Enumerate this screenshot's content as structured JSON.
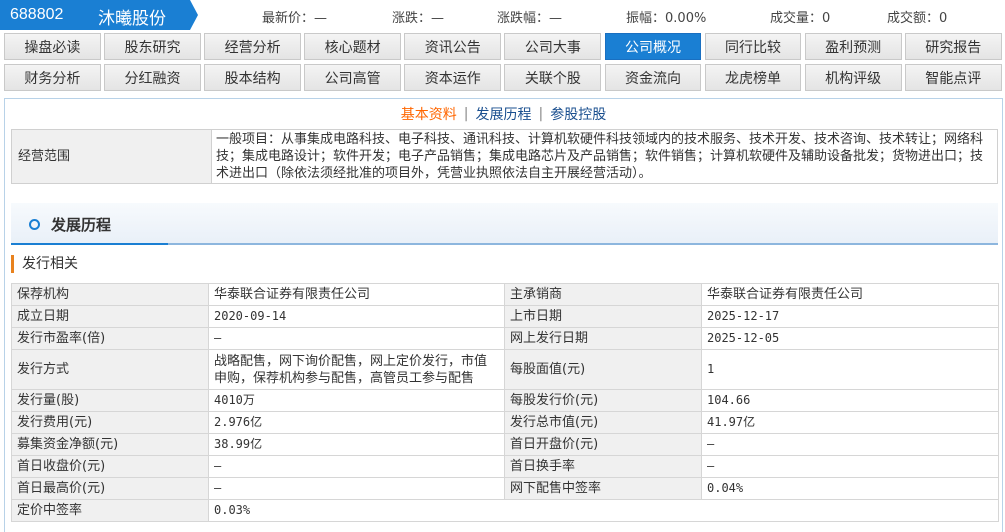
{
  "stock": {
    "code": "688802",
    "name": "沐曦股份",
    "tag_color": "#1a7fd3"
  },
  "quote": [
    {
      "label": "最新价：",
      "value": "—"
    },
    {
      "label": "涨跌：",
      "value": "—"
    },
    {
      "label": "涨跌幅：",
      "value": "—"
    },
    {
      "label": "振幅：",
      "value": "0.00%"
    },
    {
      "label": "成交量：",
      "value": "0"
    },
    {
      "label": "成交额：",
      "value": "0"
    }
  ],
  "nav": {
    "active_index": 6,
    "items": [
      "操盘必读",
      "股东研究",
      "经营分析",
      "核心题材",
      "资讯公告",
      "公司大事",
      "公司概况",
      "同行比较",
      "盈利预测",
      "研究报告",
      "财务分析",
      "分红融资",
      "股本结构",
      "公司高管",
      "资本运作",
      "关联个股",
      "资金流向",
      "龙虎榜单",
      "机构评级",
      "智能点评"
    ]
  },
  "subnav": {
    "items": [
      "基本资料",
      "发展历程",
      "参股控股"
    ],
    "current_index": 0,
    "separator": "|"
  },
  "business_scope": {
    "label": "经营范围",
    "text": "一般项目：从事集成电路科技、电子科技、通讯科技、计算机软硬件科技领域内的技术服务、技术开发、技术咨询、技术转让；网络科技；集成电路设计；软件开发；电子产品销售；集成电路芯片及产品销售；软件销售；计算机软硬件及辅助设备批发；货物进出口；技术进出口（除依法须经批准的项目外，凭营业执照依法自主开展经营活动）。"
  },
  "history": {
    "title": "发展历程",
    "subheading": "发行相关",
    "rows": [
      [
        {
          "k": "保荐机构",
          "v": "华泰联合证券有限责任公司"
        },
        {
          "k": "主承销商",
          "v": "华泰联合证券有限责任公司"
        }
      ],
      [
        {
          "k": "成立日期",
          "v": "2020-09-14"
        },
        {
          "k": "上市日期",
          "v": "2025-12-17"
        }
      ],
      [
        {
          "k": "发行市盈率(倍)",
          "v": "—"
        },
        {
          "k": "网上发行日期",
          "v": "2025-12-05"
        }
      ],
      [
        {
          "k": "发行方式",
          "v": "战略配售，网下询价配售，网上定价发行，市值申购，保荐机构参与配售，高管员工参与配售"
        },
        {
          "k": "每股面值(元)",
          "v": "1"
        }
      ],
      [
        {
          "k": "发行量(股)",
          "v": "4010万"
        },
        {
          "k": "每股发行价(元)",
          "v": "104.66"
        }
      ],
      [
        {
          "k": "发行费用(元)",
          "v": "2.976亿"
        },
        {
          "k": "发行总市值(元)",
          "v": "41.97亿"
        }
      ],
      [
        {
          "k": "募集资金净额(元)",
          "v": "38.99亿"
        },
        {
          "k": "首日开盘价(元)",
          "v": "—"
        }
      ],
      [
        {
          "k": "首日收盘价(元)",
          "v": "—"
        },
        {
          "k": "首日换手率",
          "v": "—"
        }
      ],
      [
        {
          "k": "首日最高价(元)",
          "v": "—"
        },
        {
          "k": "网下配售中签率",
          "v": "0.04%"
        }
      ],
      [
        {
          "k": "定价中签率",
          "v": "0.03%"
        }
      ]
    ]
  }
}
